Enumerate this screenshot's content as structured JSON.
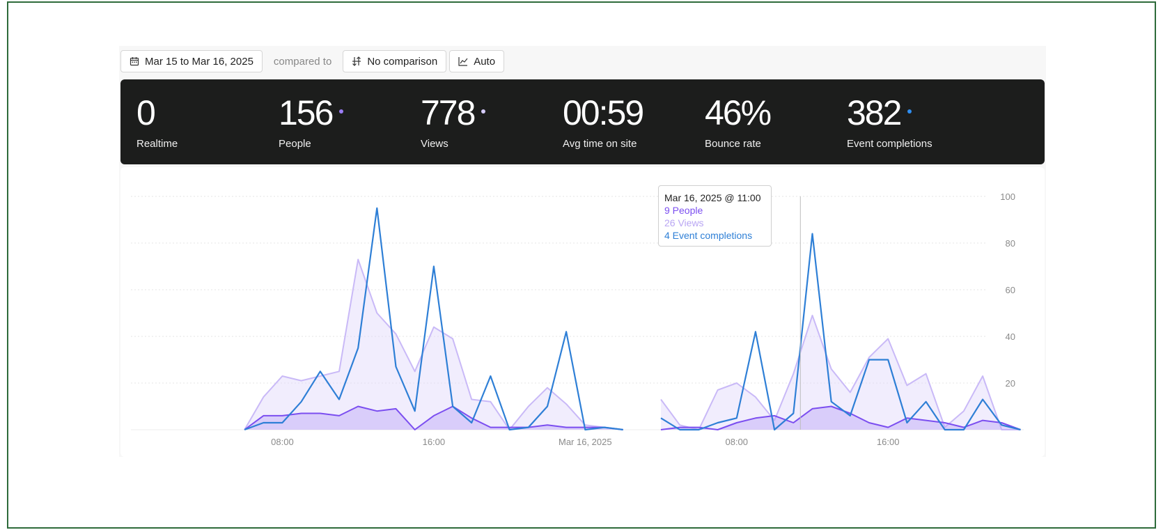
{
  "toolbar": {
    "date_range": "Mar 15 to Mar 16, 2025",
    "compared_to": "compared to",
    "comparison": "No comparison",
    "interval": "Auto"
  },
  "stats": [
    {
      "value": "0",
      "label": "Realtime",
      "dot_color": ""
    },
    {
      "value": "156",
      "label": "People",
      "dot_color": "#9b7df5"
    },
    {
      "value": "778",
      "label": "Views",
      "dot_color": "#d6ccfb"
    },
    {
      "value": "00:59",
      "label": "Avg time on site",
      "dot_color": ""
    },
    {
      "value": "46%",
      "label": "Bounce rate",
      "dot_color": ""
    },
    {
      "value": "382",
      "label": "Event completions",
      "dot_color": "#2e8df0"
    }
  ],
  "tooltip": {
    "title": "Mar 16, 2025 @ 11:00",
    "people": "9 People",
    "views": "26 Views",
    "events": "4 Event completions"
  },
  "colors": {
    "people": "#7b4ef0",
    "views": "#c9b9f7",
    "events": "#2e7fd6"
  },
  "chart_data": {
    "type": "area",
    "x_tick_labels": [
      "08:00",
      "16:00",
      "Mar 16, 2025",
      "08:00",
      "16:00"
    ],
    "ylim": [
      0,
      100
    ],
    "y_ticks": [
      20,
      40,
      60,
      80,
      100
    ],
    "grid": true,
    "legend": "none",
    "series": [
      {
        "name": "People",
        "values": [
          null,
          null,
          null,
          null,
          null,
          null,
          0,
          6,
          6,
          7,
          7,
          6,
          10,
          8,
          9,
          0,
          6,
          10,
          5,
          1,
          1,
          1,
          2,
          1,
          1,
          1,
          0,
          null,
          0,
          1,
          1,
          0,
          3,
          5,
          6,
          3,
          9,
          10,
          7,
          3,
          1,
          5,
          4,
          3,
          1,
          4,
          3,
          0,
          null
        ]
      },
      {
        "name": "Views",
        "values": [
          null,
          null,
          null,
          null,
          null,
          null,
          0,
          14,
          23,
          21,
          23,
          25,
          73,
          50,
          41,
          25,
          44,
          39,
          13,
          12,
          0,
          10,
          18,
          11,
          2,
          1,
          0,
          null,
          13,
          2,
          0,
          17,
          20,
          14,
          4,
          24,
          49,
          26,
          16,
          31,
          39,
          19,
          24,
          1,
          8,
          23,
          0,
          0,
          null
        ]
      },
      {
        "name": "Event completions",
        "values": [
          null,
          null,
          null,
          null,
          null,
          null,
          0,
          3,
          3,
          12,
          25,
          13,
          35,
          95,
          27,
          8,
          70,
          10,
          3,
          23,
          0,
          1,
          10,
          42,
          0,
          1,
          0,
          null,
          5,
          0,
          0,
          3,
          5,
          42,
          0,
          7,
          84,
          12,
          6,
          30,
          30,
          3,
          12,
          0,
          0,
          13,
          2,
          0,
          null
        ]
      }
    ],
    "highlight_index": 35
  }
}
